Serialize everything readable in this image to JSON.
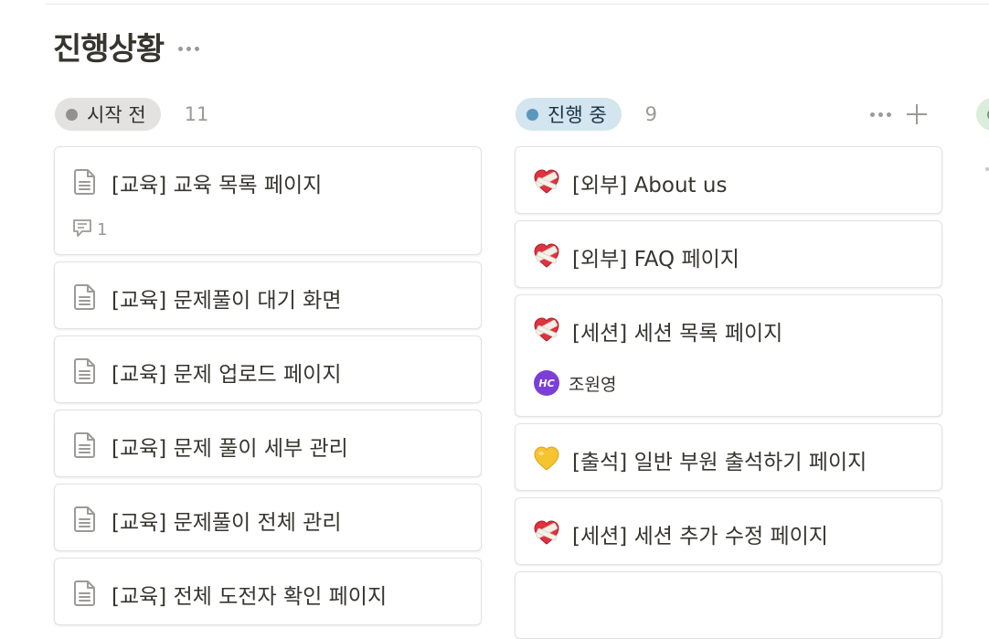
{
  "page": {
    "title": "진행상황"
  },
  "columns": [
    {
      "status": "시작 전",
      "count": "11",
      "color": "#91918e",
      "cards": [
        {
          "title": "[교육] 교육 목록 페이지",
          "icon": "document-icon",
          "comments": "1"
        },
        {
          "title": "[교육] 문제풀이 대기 화면",
          "icon": "document-icon"
        },
        {
          "title": "[교육] 문제 업로드 페이지",
          "icon": "document-icon"
        },
        {
          "title": "[교육] 문제 풀이 세부 관리",
          "icon": "document-icon"
        },
        {
          "title": "[교육] 문제풀이 전체 관리",
          "icon": "document-icon"
        },
        {
          "title": "[교육] 전체 도전자 확인 페이지",
          "icon": "document-icon"
        }
      ]
    },
    {
      "status": "진행 중",
      "count": "9",
      "color": "#5b97bd",
      "cards": [
        {
          "title": "[외부] About us",
          "icon": "mending-heart-emoji"
        },
        {
          "title": "[외부] FAQ 페이지",
          "icon": "mending-heart-emoji"
        },
        {
          "title": "[세션] 세션 목록 페이지",
          "icon": "mending-heart-emoji",
          "assignee": {
            "name": "조원영",
            "initials": "HC"
          }
        },
        {
          "title": "[출석] 일반 부원 출석하기 페이지",
          "icon": "yellow-heart-emoji"
        },
        {
          "title": "[세션] 세션 추가 수정 페이지",
          "icon": "mending-heart-emoji"
        }
      ]
    },
    {
      "status_color": "#6c9b7d"
    }
  ],
  "colors": {
    "accent_blue": "#5b97bd",
    "text": "#37352f",
    "muted": "#9b9a97"
  }
}
